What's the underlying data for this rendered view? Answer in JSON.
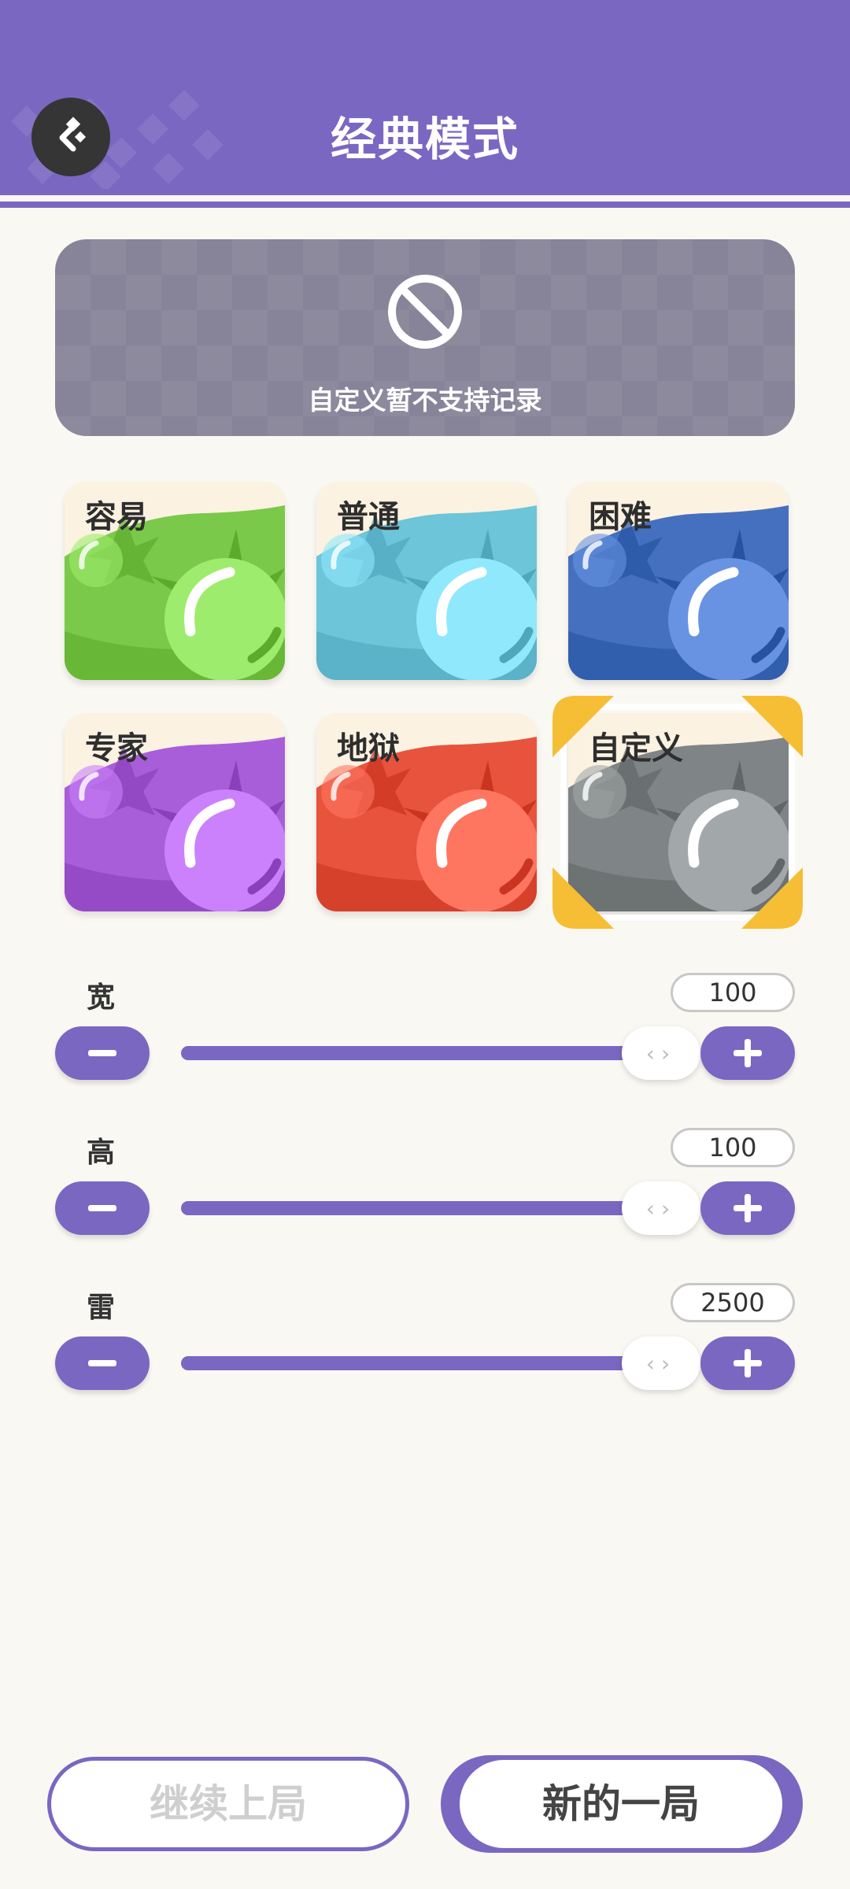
{
  "header": {
    "title": "经典模式",
    "back_icon": "back-arrow-icon",
    "color": "#7A67C1"
  },
  "notice": {
    "icon": "no-entry-icon",
    "text": "自定义暂不支持记录"
  },
  "difficulties": [
    {
      "label": "容易",
      "color": "#7BC94A",
      "selected": false
    },
    {
      "label": "普通",
      "color": "#6DC5DA",
      "selected": false
    },
    {
      "label": "困难",
      "color": "#4570C0",
      "selected": false
    },
    {
      "label": "专家",
      "color": "#A85ED8",
      "selected": false
    },
    {
      "label": "地狱",
      "color": "#E8533D",
      "selected": false
    },
    {
      "label": "自定义",
      "color": "#7F8586",
      "selected": true
    }
  ],
  "sliders": [
    {
      "label": "宽",
      "value": "100"
    },
    {
      "label": "高",
      "value": "100"
    },
    {
      "label": "雷",
      "value": "2500"
    }
  ],
  "buttons": {
    "continue": "继续上局",
    "new_game": "新的一局"
  }
}
